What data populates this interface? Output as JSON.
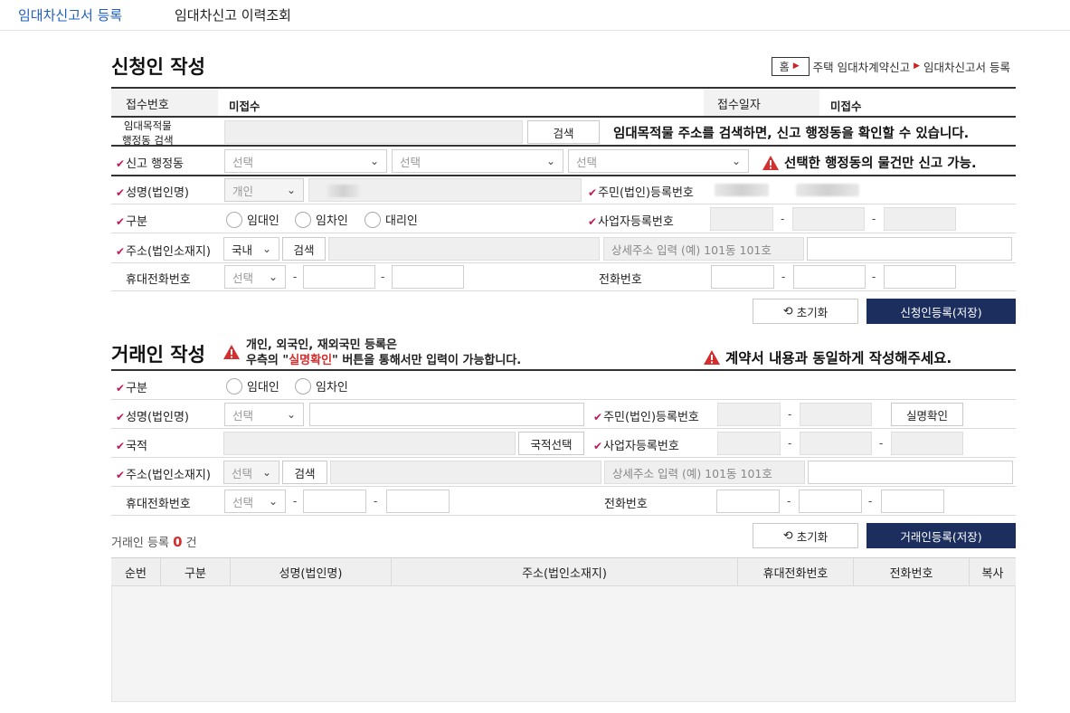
{
  "top_tabs": {
    "active": "임대차신고서 등록",
    "other": "임대차신고 이력조회"
  },
  "breadcrumb": {
    "home": "홈",
    "level1": "주택 임대차계약신고",
    "level2": "임대차신고서 등록"
  },
  "applicant": {
    "title": "신청인 작성",
    "receipt_no_label": "접수번호",
    "receipt_no_value": "미접수",
    "receipt_date_label": "접수일자",
    "receipt_date_value": "미접수",
    "property_search_label_1": "임대목적물",
    "property_search_label_2": "행정동 검색",
    "search_button": "검색",
    "property_search_notice": "임대목적물 주소를 검색하면, 신고 행정동을 확인할 수 있습니다.",
    "report_dong_label": "신고 행정동",
    "select_placeholder": "선택",
    "report_dong_notice": "선택한 행정동의 물건만 신고 가능.",
    "name_label": "성명(법인명)",
    "name_type": "개인",
    "resident_no_label": "주민(법인)등록번호",
    "type_label": "구분",
    "type_options": [
      "임대인",
      "임차인",
      "대리인"
    ],
    "biz_no_label": "사업자등록번호",
    "address_label": "주소(법인소재지)",
    "address_country": "국내",
    "address_search": "검색",
    "address_detail_placeholder": "상세주소 입력 (예) 101동 101호",
    "mobile_label": "휴대전화번호",
    "phone_label": "전화번호",
    "reset_button": "초기화",
    "save_button": "신청인등록(저장)"
  },
  "counterparty": {
    "title": "거래인 작성",
    "notice_line1": "개인, 외국인, 재외국민 등록은",
    "notice_line2_pre": "우측의 \"",
    "notice_line2_highlight": "실명확인",
    "notice_line2_post": "\" 버튼을 통해서만 입력이 가능합니다.",
    "right_notice": "계약서 내용과 동일하게 작성해주세요.",
    "type_label": "구분",
    "type_options": [
      "임대인",
      "임차인"
    ],
    "name_label": "성명(법인명)",
    "name_type": "선택",
    "resident_no_label": "주민(법인)등록번호",
    "verify_button": "실명확인",
    "nationality_label": "국적",
    "nationality_button": "국적선택",
    "biz_no_label": "사업자등록번호",
    "address_label": "주소(법인소재지)",
    "address_country": "선택",
    "address_search": "검색",
    "address_detail_placeholder": "상세주소 입력 (예) 101동 101호",
    "mobile_label": "휴대전화번호",
    "phone_label": "전화번호",
    "reset_button": "초기화",
    "save_button": "거래인등록(저장)",
    "count_prefix": "거래인 등록",
    "count_value": "0",
    "count_suffix": "건",
    "columns": [
      "순번",
      "구분",
      "성명(법인명)",
      "주소(법인소재지)",
      "휴대전화번호",
      "전화번호",
      "복사"
    ]
  },
  "colors": {
    "accent_blue": "#1f5fbf",
    "navy_button": "#1b2e5e",
    "required_mark": "#c2185b",
    "warning_red": "#d32f2f",
    "count_red": "#d32f2f"
  }
}
